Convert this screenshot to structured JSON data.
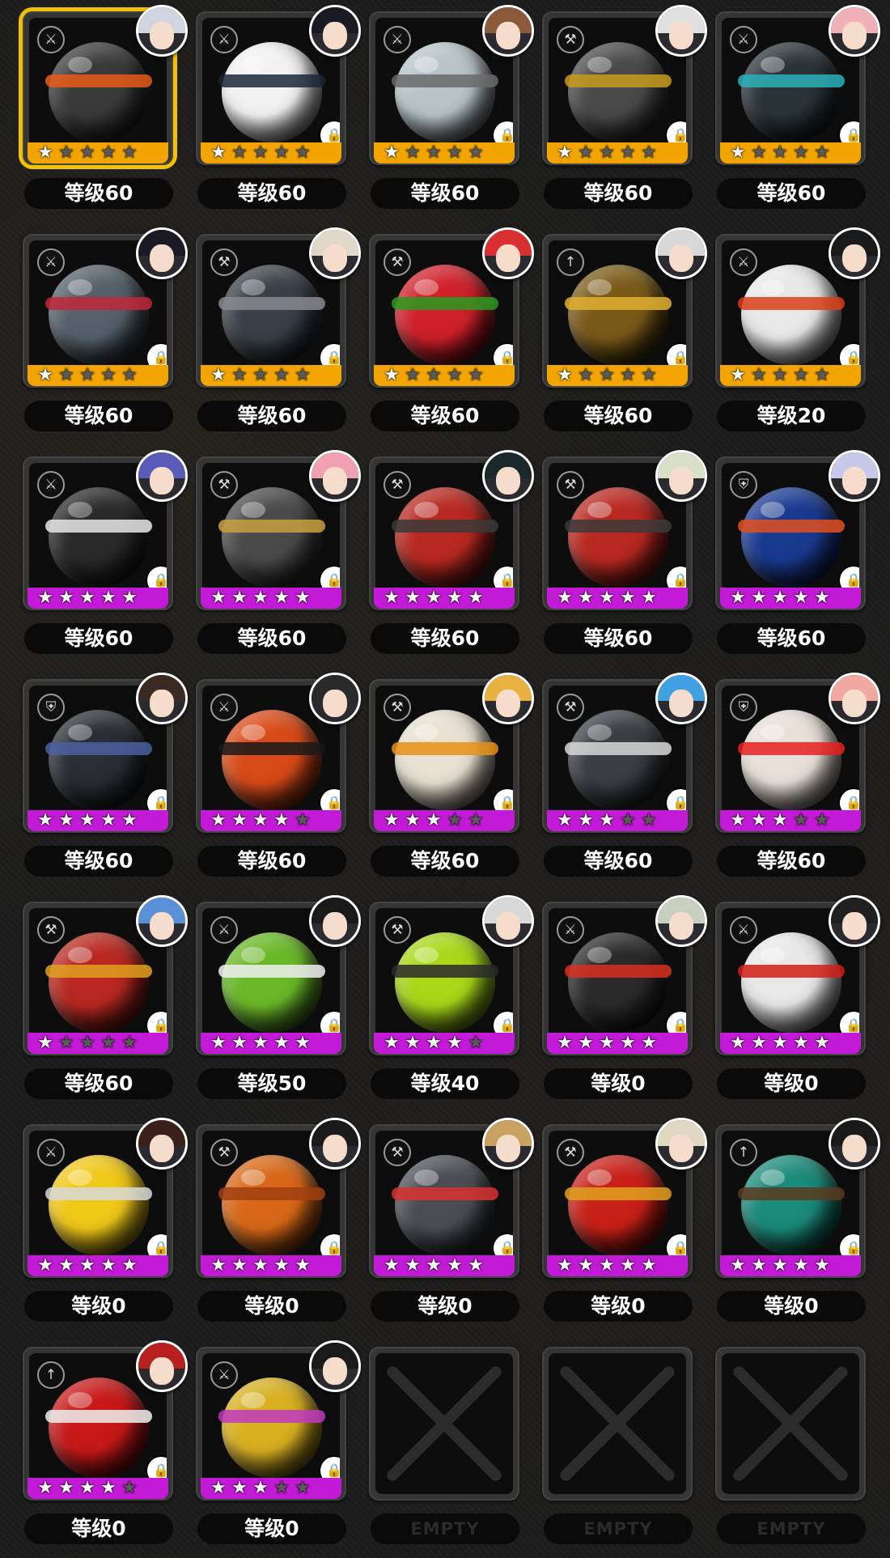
{
  "colors": {
    "selected_border": "#f2c200",
    "rarity_gold": "#f2a400",
    "rarity_purple": "#c21ad6",
    "star_on": "#ffffff",
    "star_off": "#5a5a5a",
    "panel": "#353535"
  },
  "empty_label": "EMPTY",
  "selected_index": 0,
  "items": [
    {
      "level": "等级60",
      "stars": 1,
      "rarity": "gold",
      "type_icon": "crossed-swords-icon",
      "ball_color": "#3a3a3a",
      "band_color": "#e85a1a",
      "hair_color": "#d0d6e0",
      "locked": false
    },
    {
      "level": "等级60",
      "stars": 1,
      "rarity": "gold",
      "type_icon": "crossed-swords-icon",
      "ball_color": "#f2f2f2",
      "band_color": "#1a2838",
      "hair_color": "#1a1a24",
      "locked": true
    },
    {
      "level": "等级60",
      "stars": 1,
      "rarity": "gold",
      "type_icon": "crossed-swords-icon",
      "ball_color": "#b8c4c8",
      "band_color": "#6a6a6a",
      "hair_color": "#8a5a3a",
      "locked": true
    },
    {
      "level": "等级60",
      "stars": 1,
      "rarity": "gold",
      "type_icon": "hammer-icon",
      "ball_color": "#4a4a4a",
      "band_color": "#c89a20",
      "hair_color": "#e0e0e0",
      "locked": true
    },
    {
      "level": "等级60",
      "stars": 1,
      "rarity": "gold",
      "type_icon": "crossed-swords-icon",
      "ball_color": "#2a3338",
      "band_color": "#2ab0b8",
      "hair_color": "#f0b0b8",
      "locked": true
    },
    {
      "level": "等级60",
      "stars": 1,
      "rarity": "gold",
      "type_icon": "crossed-swords-icon",
      "ball_color": "#55606a",
      "band_color": "#c0283a",
      "hair_color": "#1a1a24",
      "locked": true
    },
    {
      "level": "等级60",
      "stars": 1,
      "rarity": "gold",
      "type_icon": "sword-icon",
      "ball_color": "#3a4048",
      "band_color": "#8a8a90",
      "hair_color": "#e0d8c8",
      "locked": true
    },
    {
      "level": "等级60",
      "stars": 1,
      "rarity": "gold",
      "type_icon": "sword-icon",
      "ball_color": "#d0202a",
      "band_color": "#2a9a20",
      "hair_color": "#d83030",
      "locked": true
    },
    {
      "level": "等级60",
      "stars": 1,
      "rarity": "gold",
      "type_icon": "bow-icon",
      "ball_color": "#7a5a18",
      "band_color": "#e0b030",
      "hair_color": "#d8d8d8",
      "locked": true
    },
    {
      "level": "等级20",
      "stars": 1,
      "rarity": "gold",
      "type_icon": "crossed-swords-icon",
      "ball_color": "#e8e8e8",
      "band_color": "#d84018",
      "hair_color": "#1a1a1a",
      "locked": true
    },
    {
      "level": "等级60",
      "stars": 5,
      "rarity": "purple",
      "type_icon": "crossed-swords-icon",
      "ball_color": "#2a2a2a",
      "band_color": "#e8e8e8",
      "hair_color": "#5a5ab8",
      "locked": true
    },
    {
      "level": "等级60",
      "stars": 5,
      "rarity": "purple",
      "type_icon": "sword-icon",
      "ball_color": "#4a4a4a",
      "band_color": "#c8a040",
      "hair_color": "#f0a0b0",
      "locked": true
    },
    {
      "level": "等级60",
      "stars": 5,
      "rarity": "purple",
      "type_icon": "sword-icon",
      "ball_color": "#b82820",
      "band_color": "#3a3a3a",
      "hair_color": "#1a2a2a",
      "locked": true
    },
    {
      "level": "等级60",
      "stars": 5,
      "rarity": "purple",
      "type_icon": "sword-icon",
      "ball_color": "#b82820",
      "band_color": "#3a3a3a",
      "hair_color": "#d8e0c8",
      "locked": true
    },
    {
      "level": "等级60",
      "stars": 5,
      "rarity": "purple",
      "type_icon": "shield-icon",
      "ball_color": "#1a3a90",
      "band_color": "#e05020",
      "hair_color": "#c8c8e8",
      "locked": true
    },
    {
      "level": "等级60",
      "stars": 5,
      "rarity": "purple",
      "type_icon": "shield-icon",
      "ball_color": "#2a2e34",
      "band_color": "#4a60a0",
      "hair_color": "#3a2a24",
      "locked": true
    },
    {
      "level": "等级60",
      "stars": 4,
      "rarity": "purple",
      "type_icon": "crossed-swords-icon",
      "ball_color": "#d84a18",
      "band_color": "#1a1a1a",
      "hair_color": "#2a2a2a",
      "locked": true
    },
    {
      "level": "等级60",
      "stars": 3,
      "rarity": "purple",
      "type_icon": "hammer-icon",
      "ball_color": "#e8e0d0",
      "band_color": "#e89018",
      "hair_color": "#e8b040",
      "locked": true
    },
    {
      "level": "等级60",
      "stars": 3,
      "rarity": "purple",
      "type_icon": "sword-icon",
      "ball_color": "#3a3e44",
      "band_color": "#d8d8d8",
      "hair_color": "#40a0e0",
      "locked": true
    },
    {
      "level": "等级60",
      "stars": 3,
      "rarity": "purple",
      "type_icon": "shield-icon",
      "ball_color": "#e8e0d8",
      "band_color": "#e82020",
      "hair_color": "#f0a8a0",
      "locked": true
    },
    {
      "level": "等级60",
      "stars": 1,
      "rarity": "purple",
      "type_icon": "sword-icon",
      "ball_color": "#b82820",
      "band_color": "#e0a020",
      "hair_color": "#5a90d8",
      "locked": true
    },
    {
      "level": "等级50",
      "stars": 5,
      "rarity": "purple",
      "type_icon": "crossed-swords-icon",
      "ball_color": "#6ab828",
      "band_color": "#f0f0f0",
      "hair_color": "#1a1a1a",
      "locked": true
    },
    {
      "level": "等级40",
      "stars": 4,
      "rarity": "purple",
      "type_icon": "hammer-icon",
      "ball_color": "#a8d818",
      "band_color": "#2a2a2a",
      "hair_color": "#d8d8d8",
      "locked": true
    },
    {
      "level": "等级0",
      "stars": 5,
      "rarity": "purple",
      "type_icon": "crossed-swords-icon",
      "ball_color": "#2a2a2a",
      "band_color": "#d83020",
      "hair_color": "#c8d0c0",
      "locked": true
    },
    {
      "level": "等级0",
      "stars": 5,
      "rarity": "purple",
      "type_icon": "crossed-swords-icon",
      "ball_color": "#e8e8e8",
      "band_color": "#d02018",
      "hair_color": "#202020",
      "locked": true
    },
    {
      "level": "等级0",
      "stars": 5,
      "rarity": "purple",
      "type_icon": "crossed-swords-icon",
      "ball_color": "#f0c818",
      "band_color": "#d8d8d8",
      "hair_color": "#3a2018",
      "locked": true
    },
    {
      "level": "等级0",
      "stars": 5,
      "rarity": "purple",
      "type_icon": "hammer-icon",
      "ball_color": "#d86818",
      "band_color": "#a04010",
      "hair_color": "#1a1a1a",
      "locked": true
    },
    {
      "level": "等级0",
      "stars": 5,
      "rarity": "purple",
      "type_icon": "hammer-icon",
      "ball_color": "#4a4e54",
      "band_color": "#d83030",
      "hair_color": "#c8a060",
      "locked": true
    },
    {
      "level": "等级0",
      "stars": 5,
      "rarity": "purple",
      "type_icon": "sword-icon",
      "ball_color": "#c82018",
      "band_color": "#e0a020",
      "hair_color": "#e0d8c0",
      "locked": true
    },
    {
      "level": "等级0",
      "stars": 5,
      "rarity": "purple",
      "type_icon": "bow-icon",
      "ball_color": "#1a8a7a",
      "band_color": "#5a3a20",
      "hair_color": "#1a1a1a",
      "locked": true
    },
    {
      "level": "等级0",
      "stars": 4,
      "rarity": "purple",
      "type_icon": "bow-icon",
      "ball_color": "#c81818",
      "band_color": "#f0f0f0",
      "hair_color": "#b82020",
      "locked": true
    },
    {
      "level": "等级0",
      "stars": 3,
      "rarity": "purple",
      "type_icon": "crossed-swords-icon",
      "ball_color": "#d8b020",
      "band_color": "#c03ac0",
      "hair_color": "#1a1a1a",
      "locked": true
    },
    {
      "empty": true
    },
    {
      "empty": true
    },
    {
      "empty": true
    }
  ]
}
